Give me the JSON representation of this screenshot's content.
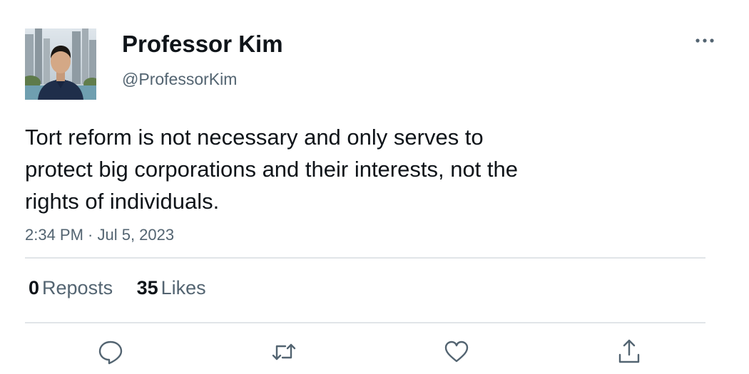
{
  "author": {
    "display_name": "Professor Kim",
    "handle": "@ProfessorKim"
  },
  "tweet": {
    "text": "Tort reform is not necessary and only serves to\nprotect big corporations and their interests, not the\nrights of individuals.",
    "timestamp": "2:34 PM · Jul 5, 2023"
  },
  "stats": {
    "reposts_count": "0",
    "reposts_label": "Reposts",
    "likes_count": "35",
    "likes_label": "Likes"
  },
  "icons": {
    "more": "more-horizontal-icon",
    "reply": "reply-icon",
    "repost": "repost-icon",
    "like": "heart-icon",
    "share": "share-icon"
  },
  "colors": {
    "text": "#0f1419",
    "muted": "#536471",
    "divider": "#e1e5e8",
    "icon": "#536471"
  }
}
